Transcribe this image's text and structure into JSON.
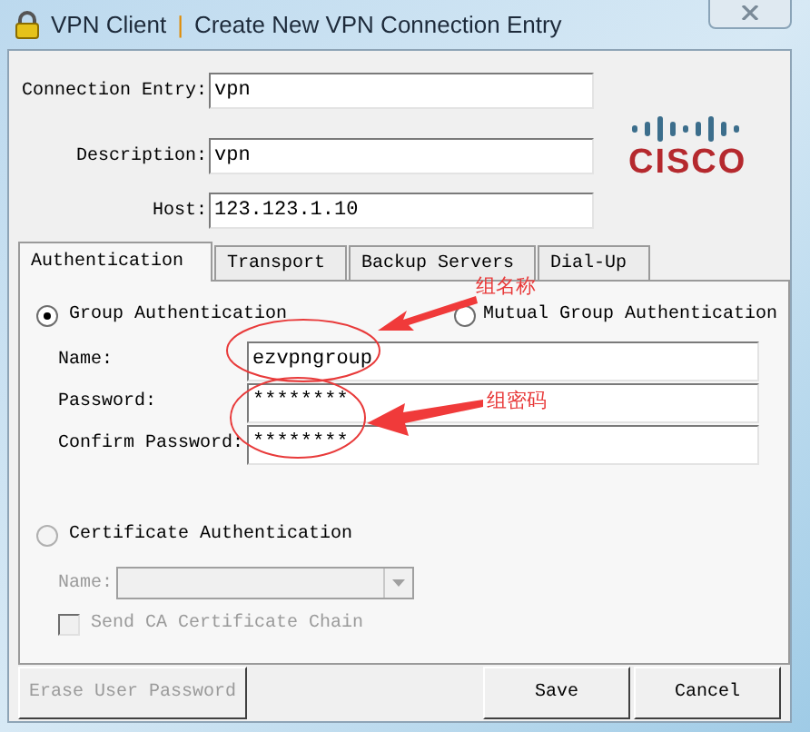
{
  "window": {
    "app_name": "VPN Client",
    "separator": "|",
    "title": "Create New VPN Connection Entry"
  },
  "fields": [
    {
      "label": "Connection Entry:",
      "value": "vpn"
    },
    {
      "label": "Description:",
      "value": "vpn"
    },
    {
      "label": "Host:",
      "value": "123.123.1.10"
    }
  ],
  "logo": {
    "text": "CISCO"
  },
  "tabs": [
    {
      "label": "Authentication",
      "selected": true
    },
    {
      "label": "Transport",
      "selected": false
    },
    {
      "label": "Backup Servers",
      "selected": false
    },
    {
      "label": "Dial-Up",
      "selected": false
    }
  ],
  "group_auth": {
    "label": "Group Authentication",
    "selected": true,
    "fields": [
      {
        "label": "Name:",
        "value": "ezvpngroup"
      },
      {
        "label": "Password:",
        "value": "********"
      },
      {
        "label": "Confirm Password:",
        "value": "********"
      }
    ]
  },
  "mutual_auth": {
    "label": "Mutual Group Authentication",
    "selected": false
  },
  "certificate_auth": {
    "label": "Certificate Authentication",
    "selected": false,
    "name_label": "Name:",
    "disabled": true,
    "checkbox": {
      "label": "Send CA Certificate Chain",
      "checked": false
    }
  },
  "buttons": [
    {
      "label": "Erase User Password",
      "disabled": true
    },
    {
      "label": "Save",
      "disabled": false
    },
    {
      "label": "Cancel",
      "disabled": false
    }
  ],
  "annotations": [
    {
      "text": "组名称"
    },
    {
      "text": "组密码"
    }
  ]
}
